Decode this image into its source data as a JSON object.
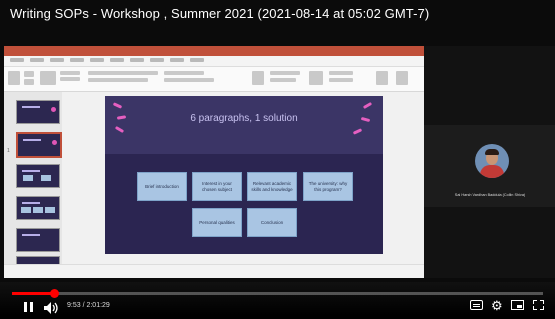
{
  "video": {
    "title": "Writing SOPs - Workshop , Summer 2021 (2021-08-14 at 05:02 GMT-7)"
  },
  "slide": {
    "title": "6 paragraphs, 1 solution",
    "cards": [
      "Brief introduction",
      "Interest in your chosen subject",
      "Relevant academic skills and knowledge",
      "The university: why this program?",
      "Personal qualities",
      "Conclusion"
    ]
  },
  "participant": {
    "name": "Sai Harsh Vardhan Baddula (Collin Shiva)"
  },
  "player": {
    "time": "9:53 / 2:01:29",
    "progress": 0.08,
    "state": "playing"
  },
  "colors": {
    "progress": "#ff0000",
    "slide_bg": "#2b2551",
    "card_bg": "#a9c5e3",
    "accent": "#e45fc0"
  }
}
